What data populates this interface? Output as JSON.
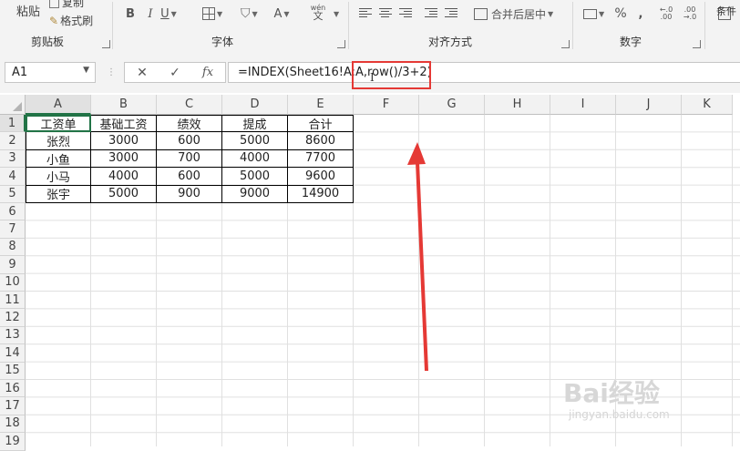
{
  "ribbon": {
    "paste_label": "粘贴",
    "copy_label": "复制",
    "format_painter_label": "格式刷",
    "groups": {
      "clipboard": "剪贴板",
      "font": "字体",
      "alignment": "对齐方式",
      "number": "数字",
      "styles": "条件"
    },
    "merge_center_label": "合并后居中",
    "font_buttons": {
      "bold": "B",
      "italic": "I",
      "underline": "U",
      "font_color": "A",
      "wen": "wén",
      "wen_char": "文"
    },
    "number_buttons": {
      "percent": "%",
      "comma": ",",
      "inc_decimal": ".00→.0",
      "dec_decimal": ".0→.00"
    }
  },
  "formula_bar": {
    "name_box": "A1",
    "fx_label": "fx",
    "formula": "=INDEX(Sheet16!A:A,row()/3+2)"
  },
  "sheet": {
    "columns": [
      "A",
      "B",
      "C",
      "D",
      "E",
      "F",
      "G",
      "H",
      "I",
      "J",
      "K"
    ],
    "rows": [
      "1",
      "2",
      "3",
      "4",
      "5",
      "6",
      "7",
      "8",
      "9",
      "10",
      "11",
      "12",
      "13",
      "14",
      "15",
      "16",
      "17",
      "18",
      "19"
    ],
    "table": {
      "headers": [
        "工资单",
        "基础工资",
        "绩效",
        "提成",
        "合计"
      ],
      "data": [
        [
          "张烈",
          "3000",
          "600",
          "5000",
          "8600"
        ],
        [
          "小鱼",
          "3000",
          "700",
          "4000",
          "7700"
        ],
        [
          "小马",
          "4000",
          "600",
          "5000",
          "9600"
        ],
        [
          "张宇",
          "5000",
          "900",
          "9000",
          "14900"
        ]
      ]
    }
  },
  "watermark": {
    "main": "Bai经验",
    "sub": "jingyan.baidu.com"
  },
  "colors": {
    "annotation_red": "#e53935",
    "ribbon_bg": "#f3f3f3",
    "header_bg": "#f2f2f2"
  }
}
